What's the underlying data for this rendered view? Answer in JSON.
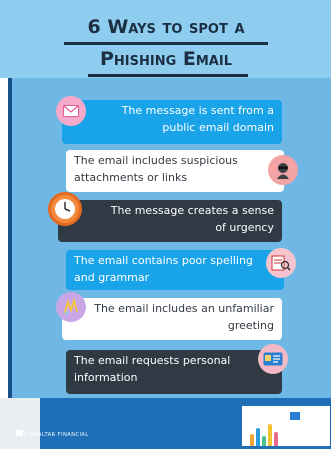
{
  "header": {
    "title_line1": "6 Ways to spot a",
    "title_line2": "Phishing Email"
  },
  "items": [
    {
      "line1": "The message is sent from a",
      "line2": "public email domain",
      "icon": "envelope-icon",
      "style": "blue"
    },
    {
      "line1": "The email includes suspicious",
      "line2": "attachments or links",
      "icon": "hacker-icon",
      "style": "white"
    },
    {
      "line1": "The message creates a sense",
      "line2": "of urgency",
      "icon": "clock-icon",
      "style": "dark"
    },
    {
      "line1": "The email contains poor spelling",
      "line2": "and grammar",
      "icon": "document-search-icon",
      "style": "blue"
    },
    {
      "line1": "The email includes an unfamiliar",
      "line2": "greeting",
      "icon": "greeting-icon",
      "style": "white"
    },
    {
      "line1": "The email requests personal",
      "line2": "information",
      "icon": "id-card-icon",
      "style": "dark"
    }
  ],
  "footer": {
    "brand": "GIBRALTAR FINANCIAL"
  },
  "colors": {
    "accent_blue": "#19a3e8",
    "dark_card": "#2f3a44",
    "panel": "#6fb8e6",
    "footer": "#1e6fb8"
  }
}
